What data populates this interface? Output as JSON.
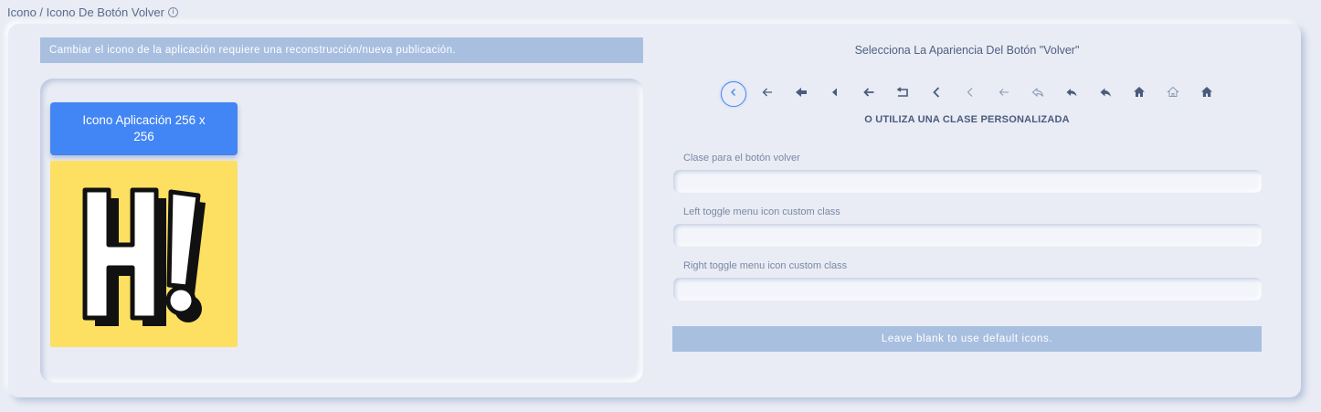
{
  "breadcrumb": {
    "text": "Icono / Icono De Botón Volver"
  },
  "left": {
    "notice": "Cambiar el icono de la aplicación requiere una reconstrucción/nueva publicación.",
    "icon_button": "Icono Aplicación 256 x 256",
    "icon_background": "#fde062"
  },
  "right": {
    "title": "Selecciona La Apariencia Del Botón \"Volver\"",
    "options": [
      "chevron-left-circle-icon",
      "arrow-left-thin-icon",
      "arrow-left-bold-icon",
      "caret-left-icon",
      "arrow-left-icon",
      "return-box-icon",
      "chevron-left-bold-icon",
      "chevron-left-light-icon",
      "arrow-left-light-icon",
      "reply-outline-icon",
      "reply-icon",
      "reply-solid-icon",
      "home-solid-icon",
      "home-outline-icon",
      "home-icon"
    ],
    "selected_option": 0,
    "custom_title": "O UTILIZA UNA CLASE PERSONALIZADA",
    "fields": {
      "back_class_label": "Clase para el botón volver",
      "left_toggle_label": "Left toggle menu icon custom class",
      "right_toggle_label": "Right toggle menu icon custom class"
    },
    "note": "Leave blank to use default icons."
  },
  "colors": {
    "accent": "#4285f4",
    "notice_bg": "#a8bfe0",
    "page_bg": "#e9ecf4"
  }
}
